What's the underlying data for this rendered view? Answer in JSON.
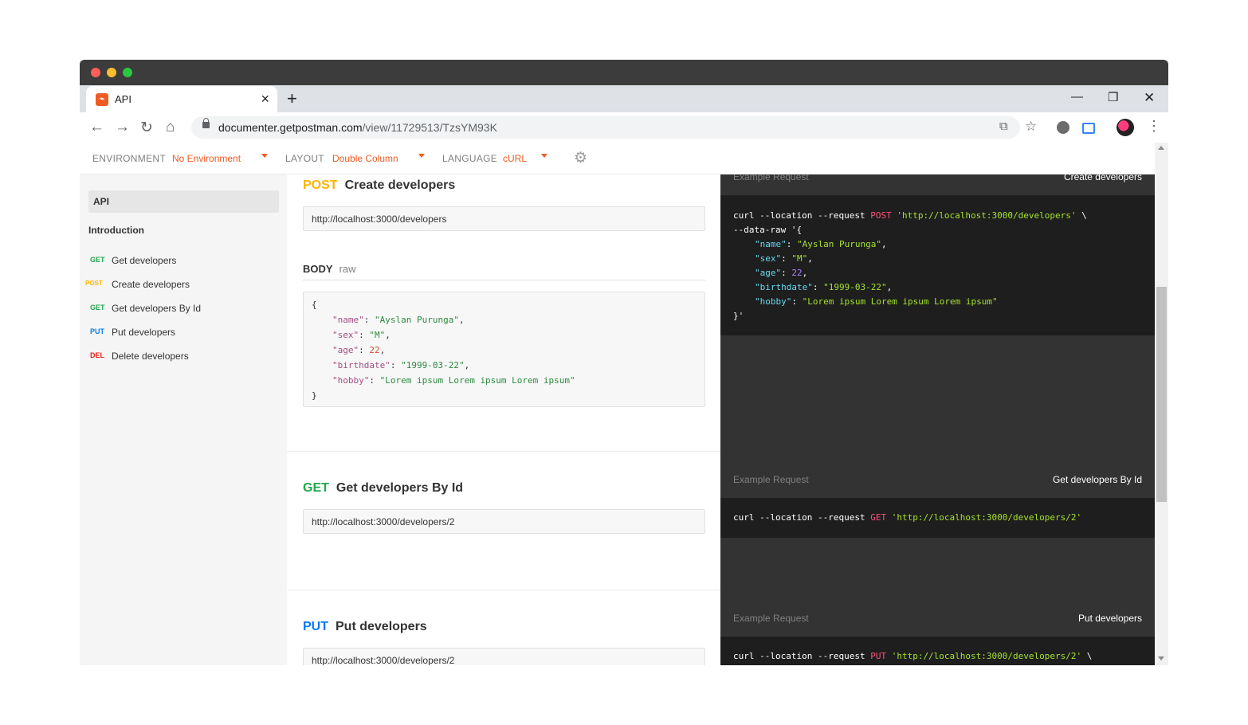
{
  "browser": {
    "tab_title": "API",
    "url_host": "documenter.getpostman.com",
    "url_path": "/view/11729513/TzsYM93K"
  },
  "toolbar": {
    "environment_label": "ENVIRONMENT",
    "environment_value": "No Environment",
    "layout_label": "LAYOUT",
    "layout_value": "Double Column",
    "language_label": "LANGUAGE",
    "language_value": "cURL"
  },
  "sidebar": {
    "api": "API",
    "introduction": "Introduction",
    "items": [
      {
        "method": "GET",
        "label": "Get developers"
      },
      {
        "method": "POST",
        "label": "Create developers"
      },
      {
        "method": "GET",
        "label": "Get developers By Id"
      },
      {
        "method": "PUT",
        "label": "Put developers"
      },
      {
        "method": "DEL",
        "label": "Delete developers"
      }
    ]
  },
  "colors": {
    "GET": "#1fa84a",
    "POST": "#ffb400",
    "PUT": "#097bed",
    "DEL": "#eb2013",
    "accent": "#ef5b25"
  },
  "sections": [
    {
      "method": "POST",
      "title": "Create developers",
      "url": "http://localhost:3000/developers",
      "body_label": "BODY",
      "body_type": "raw",
      "body_lines": {
        "open": "{",
        "name_key": "\"name\"",
        "name_val": "\"Ayslan Purunga\"",
        "sex_key": "\"sex\"",
        "sex_val": "\"M\"",
        "age_key": "\"age\"",
        "age_val": "22",
        "birthdate_key": "\"birthdate\"",
        "birthdate_val": "\"1999-03-22\"",
        "hobby_key": "\"hobby\"",
        "hobby_val": "\"Lorem ipsum Lorem ipsum Lorem ipsum\"",
        "close": "}"
      }
    },
    {
      "method": "GET",
      "title": "Get developers By Id",
      "url": "http://localhost:3000/developers/2"
    },
    {
      "method": "PUT",
      "title": "Put developers",
      "url": "http://localhost:3000/developers/2"
    }
  ],
  "examples": [
    {
      "label": "Example Request",
      "title": "Create developers",
      "curl": "curl --location --request",
      "method": "POST",
      "url": "'http://localhost:3000/developers'",
      "cont": "\\",
      "data_raw": "--data-raw '{",
      "end": "}'"
    },
    {
      "label": "Example Request",
      "title": "Get developers By Id",
      "curl": "curl --location --request",
      "method": "GET",
      "url": "'http://localhost:3000/developers/2'"
    },
    {
      "label": "Example Request",
      "title": "Put developers",
      "curl": "curl --location --request",
      "method": "PUT",
      "url": "'http://localhost:3000/developers/2'",
      "cont": "\\"
    }
  ]
}
